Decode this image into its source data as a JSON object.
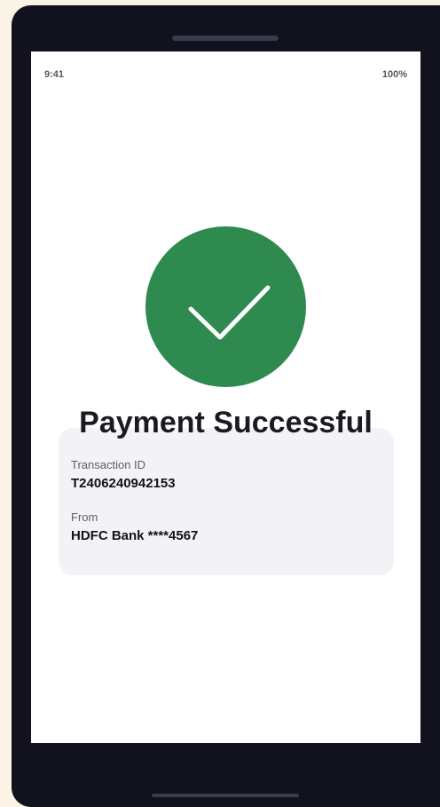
{
  "status_bar": {
    "time": "9:41",
    "battery": "100%"
  },
  "success": {
    "icon": "checkmark-icon",
    "color": "#2e8a4f"
  },
  "title": "Payment Successful",
  "details": [
    {
      "label": "Transaction ID",
      "value": "T2406240942153"
    },
    {
      "label": "From",
      "value": "HDFC Bank ****4567"
    }
  ]
}
